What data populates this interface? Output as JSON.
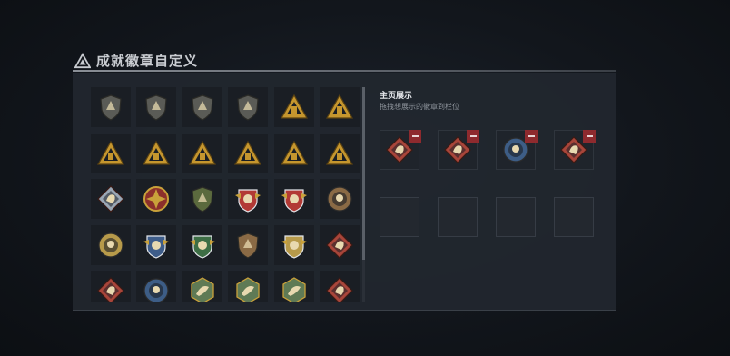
{
  "page": {
    "title": "成就徽章自定义"
  },
  "showcase": {
    "title": "主页展示",
    "hint": "拖拽想展示的徽章到栏位",
    "filled_slots": [
      {
        "icon": "red-diamond-ghost-badge-icon",
        "color": "#a8453a"
      },
      {
        "icon": "red-diamond-knight-badge-icon",
        "color": "#a8453a"
      },
      {
        "icon": "blue-round-crest-badge-icon",
        "color": "#3d5d86"
      },
      {
        "icon": "red-diamond-dragon-badge-icon",
        "color": "#a8453a"
      }
    ],
    "empty_slot_count": 4
  },
  "badges": [
    {
      "icon": "shield-pyramid-badge-icon",
      "shape": "shield",
      "color": "#5a5b56"
    },
    {
      "icon": "shield-helicopter-badge-icon",
      "shape": "shield",
      "color": "#5a5b56"
    },
    {
      "icon": "shield-diamond-badge-icon",
      "shape": "shield",
      "color": "#5a5b56"
    },
    {
      "icon": "shield-arrow-badge-icon",
      "shape": "shield",
      "color": "#5a5b56"
    },
    {
      "icon": "gold-triangle-house-badge-icon",
      "shape": "triangle",
      "color": "#c5962e"
    },
    {
      "icon": "gold-triangle-chart-badge-icon",
      "shape": "triangle",
      "color": "#c5962e"
    },
    {
      "icon": "gold-triangle-star-badge-icon",
      "shape": "triangle",
      "color": "#c5962e"
    },
    {
      "icon": "gold-triangle-tower-badge-icon",
      "shape": "triangle",
      "color": "#c5962e"
    },
    {
      "icon": "gold-triangle-eye-badge-icon",
      "shape": "triangle",
      "color": "#c5962e"
    },
    {
      "icon": "gold-triangle-figure-badge-icon",
      "shape": "triangle",
      "color": "#c5962e"
    },
    {
      "icon": "gold-triangle-bottle-badge-icon",
      "shape": "triangle",
      "color": "#c5962e"
    },
    {
      "icon": "gold-triangle-soldier-badge-icon",
      "shape": "triangle",
      "color": "#c5962e"
    },
    {
      "icon": "silver-diamond-badge-icon",
      "shape": "diamond",
      "color": "#9aa7b5"
    },
    {
      "icon": "cross-medal-badge-icon",
      "shape": "medal",
      "color": "#c9a13a"
    },
    {
      "icon": "green-shield-wings-badge-icon",
      "shape": "shield",
      "color": "#5b6a3e"
    },
    {
      "icon": "red-blue-shield-star-badge-icon",
      "shape": "crest",
      "color": "#b23a35"
    },
    {
      "icon": "red-shield-eagle-badge-icon",
      "shape": "crest",
      "color": "#b23a35"
    },
    {
      "icon": "bronze-circle-skull-badge-icon",
      "shape": "circle",
      "color": "#8a6a45"
    },
    {
      "icon": "gold-round-helmet-badge-icon",
      "shape": "circle",
      "color": "#b79a4a"
    },
    {
      "icon": "blue-wings-crest-badge-icon",
      "shape": "crest",
      "color": "#3e5d8a"
    },
    {
      "icon": "green-wings-crest-badge-icon",
      "shape": "crest",
      "color": "#3d6e45"
    },
    {
      "icon": "bronze-shield-rifle-badge-icon",
      "shape": "shield",
      "color": "#8a6a45"
    },
    {
      "icon": "gold-crest-grenade-badge-icon",
      "shape": "crest",
      "color": "#b79a4a"
    },
    {
      "icon": "red-diamond-wolf-badge-icon",
      "shape": "diamond",
      "color": "#a8453a"
    },
    {
      "icon": "red-diamond-dog-badge-icon",
      "shape": "diamond",
      "color": "#a8453a"
    },
    {
      "icon": "blue-round-beast-badge-icon",
      "shape": "circle",
      "color": "#3d5d86"
    },
    {
      "icon": "green-hexagon-fox-badge-icon",
      "shape": "hexagon",
      "color": "#5f7a55"
    },
    {
      "icon": "green-hexagon-hawk-badge-icon",
      "shape": "hexagon",
      "color": "#5f7a55"
    },
    {
      "icon": "green-hexagon-bird-badge-icon",
      "shape": "hexagon",
      "color": "#5f7a55"
    },
    {
      "icon": "red-diamond-dragon-badge-icon",
      "shape": "diamond",
      "color": "#a8453a"
    }
  ]
}
